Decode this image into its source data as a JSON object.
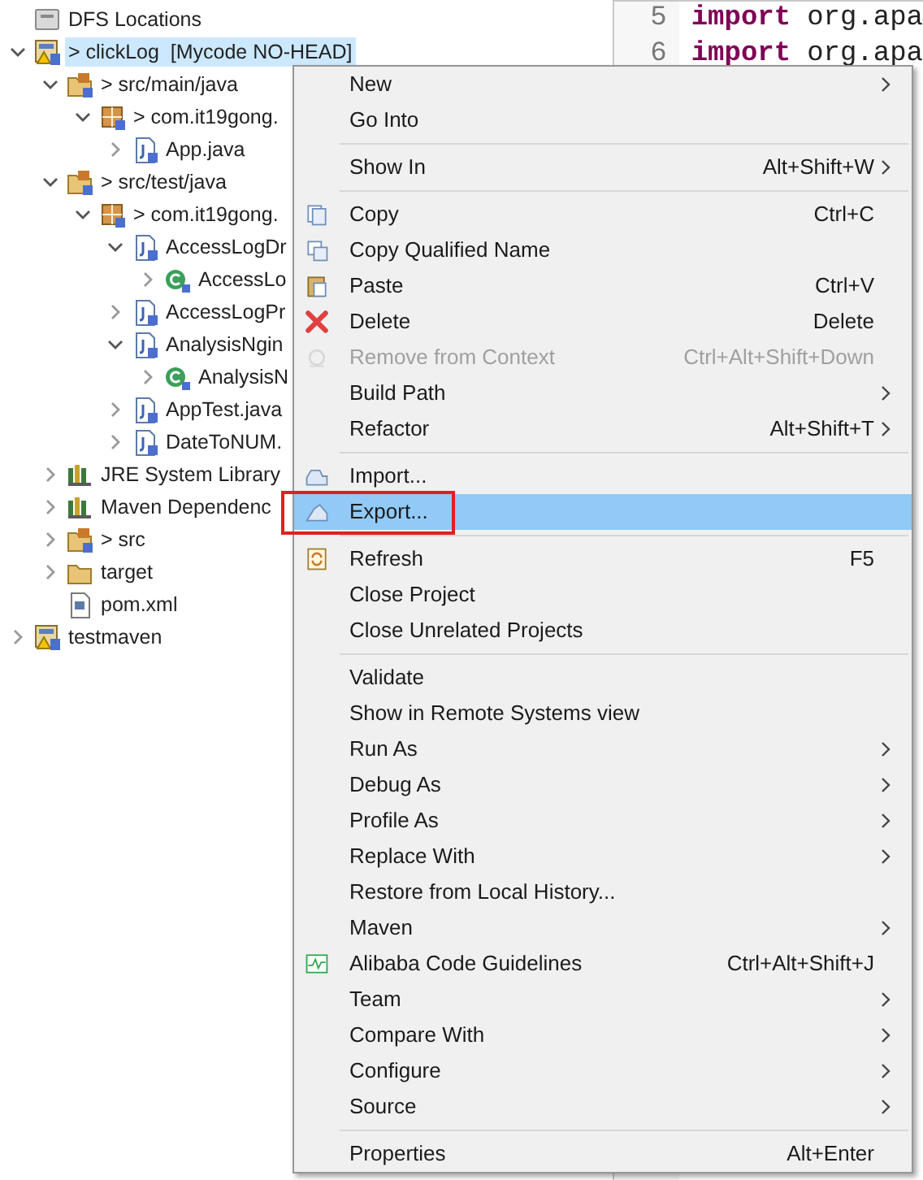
{
  "tree": [
    {
      "label": "DFS Locations",
      "kind": "drive",
      "selected": false
    },
    {
      "label": "> clickLog  [Mycode NO-HEAD]",
      "kind": "project",
      "selected": true,
      "expanded": true,
      "children": [
        {
          "label": "> src/main/java",
          "kind": "source",
          "selected": false,
          "expanded": true,
          "children": [
            {
              "label": "> com.it19gong.",
              "kind": "package",
              "selected": false,
              "expanded": true,
              "children": [
                {
                  "label": "App.java",
                  "kind": "java",
                  "selected": false,
                  "expanded": false
                }
              ]
            }
          ]
        },
        {
          "label": "> src/test/java",
          "kind": "source",
          "selected": false,
          "expanded": true,
          "children": [
            {
              "label": "> com.it19gong.",
              "kind": "package",
              "selected": false,
              "expanded": true,
              "children": [
                {
                  "label": "AccessLogDr",
                  "kind": "java",
                  "selected": false,
                  "expanded": true,
                  "children": [
                    {
                      "label": "AccessLo",
                      "kind": "class",
                      "selected": false,
                      "expanded": false
                    }
                  ]
                },
                {
                  "label": "AccessLogPr",
                  "kind": "java",
                  "selected": false,
                  "expanded": false
                },
                {
                  "label": "AnalysisNgin",
                  "kind": "java",
                  "selected": false,
                  "expanded": true,
                  "children": [
                    {
                      "label": "AnalysisN",
                      "kind": "class",
                      "selected": false,
                      "expanded": false
                    }
                  ]
                },
                {
                  "label": "AppTest.java",
                  "kind": "java",
                  "selected": false,
                  "expanded": false
                },
                {
                  "label": "DateToNUM.",
                  "kind": "java",
                  "selected": false,
                  "expanded": false
                }
              ]
            }
          ]
        },
        {
          "label": "JRE System Library",
          "kind": "library",
          "selected": false,
          "expanded": false
        },
        {
          "label": "Maven Dependenc",
          "kind": "library",
          "selected": false,
          "expanded": false
        },
        {
          "label": "> src",
          "kind": "source",
          "selected": false,
          "expanded": false
        },
        {
          "label": "target",
          "kind": "folder",
          "selected": false,
          "expanded": false
        },
        {
          "label": "pom.xml",
          "kind": "xml",
          "selected": false
        }
      ]
    },
    {
      "label": "testmaven",
      "kind": "project",
      "selected": false,
      "expanded": false
    }
  ],
  "editor": {
    "lines": [
      {
        "number": "5",
        "keyword": "import",
        "text": "org.apa"
      },
      {
        "number": "6",
        "keyword": "import",
        "text": "org.apa"
      }
    ]
  },
  "context_menu": {
    "items": [
      {
        "kind": "item",
        "label": "New",
        "submenu": true,
        "selected": false
      },
      {
        "kind": "item",
        "label": "Go Into",
        "selected": false
      },
      {
        "kind": "separator"
      },
      {
        "kind": "item",
        "label": "Show In",
        "shortcut": "Alt+Shift+W",
        "submenu": true,
        "selected": false
      },
      {
        "kind": "separator"
      },
      {
        "kind": "copy",
        "label": "Copy",
        "shortcut": "Ctrl+C",
        "selected": false
      },
      {
        "kind": "copyname",
        "label": "Copy Qualified Name",
        "selected": false
      },
      {
        "kind": "paste",
        "label": "Paste",
        "shortcut": "Ctrl+V",
        "selected": false
      },
      {
        "kind": "delete",
        "label": "Delete",
        "shortcut": "Delete",
        "selected": false
      },
      {
        "kind": "remove",
        "label": "Remove from Context",
        "shortcut": "Ctrl+Alt+Shift+Down",
        "disabled": true,
        "selected": false
      },
      {
        "kind": "item",
        "label": "Build Path",
        "submenu": true,
        "selected": false
      },
      {
        "kind": "item",
        "label": "Refactor",
        "shortcut": "Alt+Shift+T",
        "submenu": true,
        "selected": false
      },
      {
        "kind": "separator"
      },
      {
        "kind": "import",
        "label": "Import...",
        "selected": false
      },
      {
        "kind": "export",
        "label": "Export...",
        "selected": true,
        "annotated": true
      },
      {
        "kind": "separator"
      },
      {
        "kind": "refresh",
        "label": "Refresh",
        "shortcut": "F5",
        "selected": false
      },
      {
        "kind": "item",
        "label": "Close Project",
        "selected": false
      },
      {
        "kind": "item",
        "label": "Close Unrelated Projects",
        "selected": false
      },
      {
        "kind": "separator"
      },
      {
        "kind": "item",
        "label": "Validate",
        "selected": false
      },
      {
        "kind": "item",
        "label": "Show in Remote Systems view",
        "selected": false
      },
      {
        "kind": "item",
        "label": "Run As",
        "submenu": true,
        "selected": false
      },
      {
        "kind": "item",
        "label": "Debug As",
        "submenu": true,
        "selected": false
      },
      {
        "kind": "item",
        "label": "Profile As",
        "submenu": true,
        "selected": false
      },
      {
        "kind": "item",
        "label": "Replace With",
        "submenu": true,
        "selected": false
      },
      {
        "kind": "item",
        "label": "Restore from Local History...",
        "selected": false
      },
      {
        "kind": "item",
        "label": "Maven",
        "submenu": true,
        "selected": false
      },
      {
        "kind": "pulse",
        "label": "Alibaba Code Guidelines",
        "shortcut": "Ctrl+Alt+Shift+J",
        "selected": false
      },
      {
        "kind": "item",
        "label": "Team",
        "submenu": true,
        "selected": false
      },
      {
        "kind": "item",
        "label": "Compare With",
        "submenu": true,
        "selected": false
      },
      {
        "kind": "item",
        "label": "Configure",
        "submenu": true,
        "selected": false
      },
      {
        "kind": "item",
        "label": "Source",
        "submenu": true,
        "selected": false
      },
      {
        "kind": "separator"
      },
      {
        "kind": "item",
        "label": "Properties",
        "shortcut": "Alt+Enter",
        "selected": false
      }
    ]
  }
}
